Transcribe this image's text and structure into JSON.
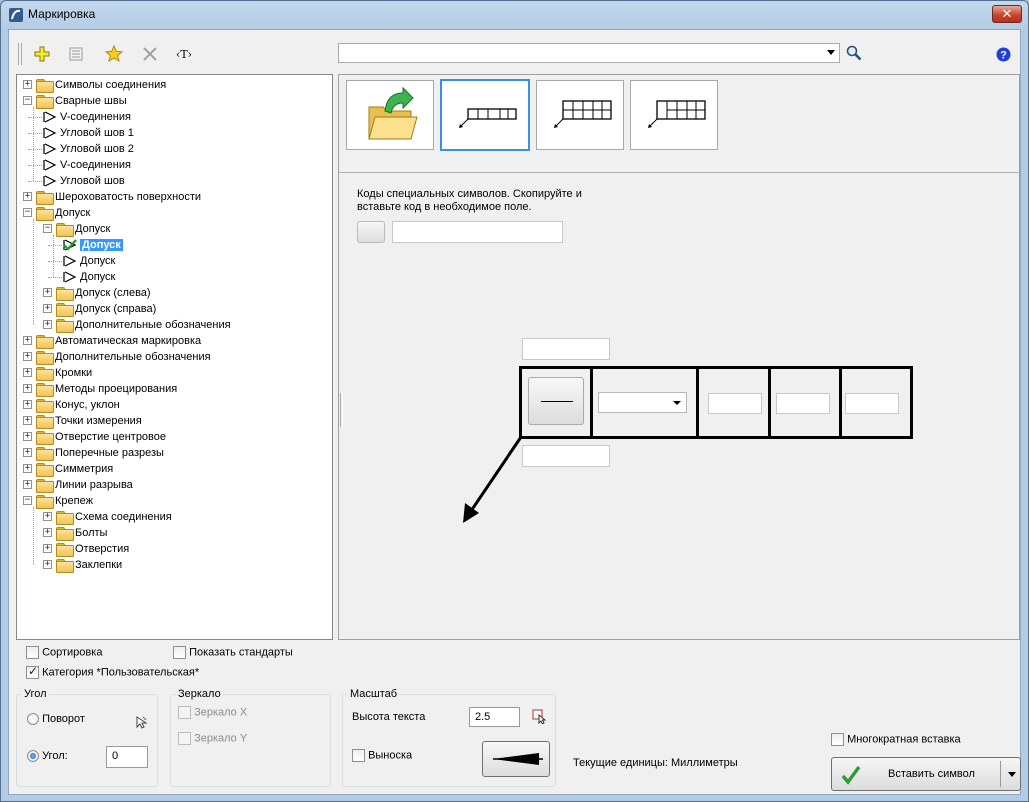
{
  "window": {
    "title": "Маркировка",
    "close_label": "✕"
  },
  "toolbar": {
    "search_value": "",
    "icons": [
      "add-icon",
      "list-icon",
      "favorite-star-icon",
      "delete-x-icon",
      "text-tag-icon",
      "search-icon",
      "help-icon"
    ],
    "text_tag_label": "‹T›",
    "help_label": "?"
  },
  "tree": {
    "items": [
      {
        "label": "Символы соединения",
        "level": 0,
        "type": "folder",
        "expanded": false
      },
      {
        "label": "Сварные швы",
        "level": 0,
        "type": "folder",
        "expanded": true
      },
      {
        "label": "V-соединения",
        "level": 1,
        "type": "symbol"
      },
      {
        "label": "Угловой шов 1",
        "level": 1,
        "type": "symbol"
      },
      {
        "label": "Угловой шов 2",
        "level": 1,
        "type": "symbol"
      },
      {
        "label": "V-соединения",
        "level": 1,
        "type": "symbol"
      },
      {
        "label": "Угловой шов",
        "level": 1,
        "type": "symbol"
      },
      {
        "label": "Шероховатость поверхности",
        "level": 0,
        "type": "folder",
        "expanded": false
      },
      {
        "label": "Допуск",
        "level": 0,
        "type": "folder",
        "expanded": true
      },
      {
        "label": "Допуск",
        "level": 1,
        "type": "folder",
        "expanded": true
      },
      {
        "label": "Допуск",
        "level": 2,
        "type": "symbol-check",
        "selected": true
      },
      {
        "label": "Допуск",
        "level": 2,
        "type": "symbol"
      },
      {
        "label": "Допуск",
        "level": 2,
        "type": "symbol"
      },
      {
        "label": "Допуск (слева)",
        "level": 1,
        "type": "folder",
        "expanded": false
      },
      {
        "label": "Допуск (справа)",
        "level": 1,
        "type": "folder",
        "expanded": false
      },
      {
        "label": "Дополнительные обозначения",
        "level": 1,
        "type": "folder",
        "expanded": false
      },
      {
        "label": "Автоматическая маркировка",
        "level": 0,
        "type": "folder",
        "expanded": false
      },
      {
        "label": "Дополнительные обозначения",
        "level": 0,
        "type": "folder",
        "expanded": false
      },
      {
        "label": "Кромки",
        "level": 0,
        "type": "folder",
        "expanded": false
      },
      {
        "label": "Методы проецирования",
        "level": 0,
        "type": "folder",
        "expanded": false
      },
      {
        "label": "Конус, уклон",
        "level": 0,
        "type": "folder",
        "expanded": false
      },
      {
        "label": "Точки измерения",
        "level": 0,
        "type": "folder",
        "expanded": false
      },
      {
        "label": "Отверстие центровое",
        "level": 0,
        "type": "folder",
        "expanded": false
      },
      {
        "label": "Поперечные разрезы",
        "level": 0,
        "type": "folder",
        "expanded": false
      },
      {
        "label": "Симметрия",
        "level": 0,
        "type": "folder",
        "expanded": false
      },
      {
        "label": "Линии разрыва",
        "level": 0,
        "type": "folder",
        "expanded": false
      },
      {
        "label": "Крепеж",
        "level": 0,
        "type": "folder",
        "expanded": true
      },
      {
        "label": "Схема соединения",
        "level": 1,
        "type": "folder",
        "expanded": false
      },
      {
        "label": "Болты",
        "level": 1,
        "type": "folder",
        "expanded": false
      },
      {
        "label": "Отверстия",
        "level": 1,
        "type": "folder",
        "expanded": false
      },
      {
        "label": "Заклепки",
        "level": 1,
        "type": "folder",
        "expanded": false
      }
    ]
  },
  "gallery": {
    "active_index": 1,
    "icons": [
      "open-folder-icon",
      "frame-1-row-icon",
      "frame-2-rows-icon",
      "frame-2-rows-wide-icon"
    ]
  },
  "special_codes": {
    "hint": "Коды специальных символов. Скопируйте и\nвставьте код в необходимое поле.",
    "code_value": ""
  },
  "frame_editor": {
    "top_text": "",
    "bottom_text": "",
    "dropdown_value": "",
    "field1": "",
    "field2": "",
    "field3": ""
  },
  "options": {
    "sort_label": "Сортировка",
    "sort_checked": false,
    "show_standards_label": "Показать стандарты",
    "show_standards_checked": false,
    "category_label": "Категория *Пользовательская*",
    "category_checked": true
  },
  "angle": {
    "group_title": "Угол",
    "rotation_label": "Поворот",
    "angle_label": "Угол:",
    "angle_value": "0",
    "selected": "angle"
  },
  "mirror": {
    "group_title": "Зеркало",
    "mirror_x_label": "Зеркало X",
    "mirror_y_label": "Зеркало Y"
  },
  "scale": {
    "group_title": "Масштаб",
    "text_height_label": "Высота текста",
    "text_height_value": "2.5",
    "leader_label": "Выноска",
    "leader_checked": false
  },
  "units_label": "Текущие единицы: Миллиметры",
  "multi_insert_label": "Многократная вставка",
  "multi_insert_checked": false,
  "insert_button_label": "Вставить символ"
}
